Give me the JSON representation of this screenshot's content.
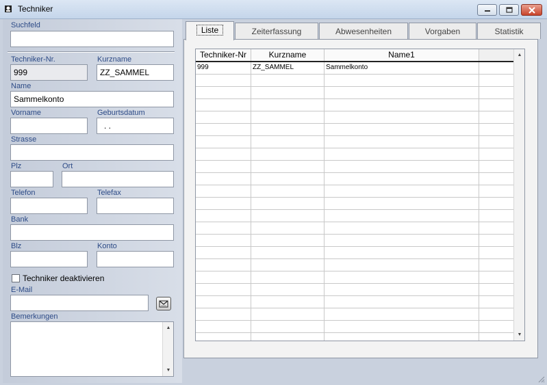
{
  "window": {
    "title": "Techniker",
    "icon": "app-icon",
    "buttons": [
      "minimize-icon",
      "maximize-icon",
      "close-icon"
    ]
  },
  "form": {
    "suchfeld_label": "Suchfeld",
    "suchfeld_value": "",
    "techniker_nr_label": "Techniker-Nr.",
    "techniker_nr_value": "999",
    "kurzname_label": "Kurzname",
    "kurzname_value": "ZZ_SAMMEL",
    "name_label": "Name",
    "name_value": "Sammelkonto",
    "vorname_label": "Vorname",
    "vorname_value": "",
    "geburtsdatum_label": "Geburtsdatum",
    "geburtsdatum_value": " .  .",
    "strasse_label": "Strasse",
    "strasse_value": "",
    "plz_label": "Plz",
    "plz_value": "",
    "ort_label": "Ort",
    "ort_value": "",
    "telefon_label": "Telefon",
    "telefon_value": "",
    "telefax_label": "Telefax",
    "telefax_value": "",
    "bank_label": "Bank",
    "bank_value": "",
    "blz_label": "Blz",
    "blz_value": "",
    "konto_label": "Konto",
    "konto_value": "",
    "deaktivieren_label": "Techniker deaktivieren",
    "deaktivieren_checked": false,
    "email_label": "E-Mail",
    "email_value": "",
    "bemerkungen_label": "Bemerkungen",
    "bemerkungen_value": ""
  },
  "tabs": [
    {
      "label": "Liste",
      "active": true
    },
    {
      "label": "Zeiterfassung",
      "active": false
    },
    {
      "label": "Abwesenheiten",
      "active": false
    },
    {
      "label": "Vorgaben",
      "active": false
    },
    {
      "label": "Statistik",
      "active": false
    }
  ],
  "grid": {
    "columns": [
      "Techniker-Nr",
      "Kurzname",
      "Name1",
      ""
    ],
    "rows": [
      [
        "999",
        "ZZ_SAMMEL",
        "Sammelkonto",
        ""
      ]
    ]
  },
  "colors": {
    "label": "#2c4a86",
    "panel": "#c9d1de",
    "close": "#c9442b"
  }
}
